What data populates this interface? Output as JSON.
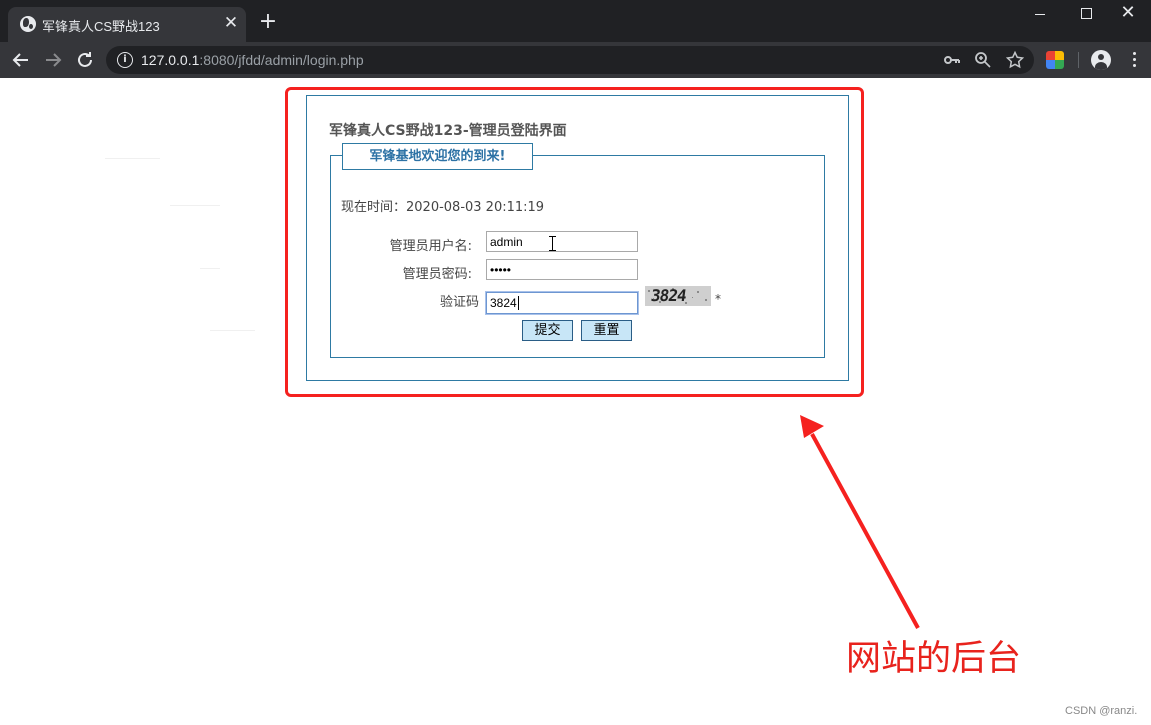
{
  "browser": {
    "tab_title": "军锋真人CS野战123",
    "tab_close": "✕",
    "new_tab": "+",
    "url_host": "127.0.0.1",
    "url_rest": ":8080/jfdd/admin/login.php",
    "window_controls": {
      "close": "✕"
    },
    "icons": [
      "globe-icon",
      "back-icon",
      "forward-icon",
      "reload-icon",
      "info-icon",
      "key-icon",
      "zoom-icon",
      "star-icon",
      "extension-icon",
      "profile-icon",
      "menu-icon"
    ]
  },
  "login": {
    "heading": "军锋真人CS野战123-管理员登陆界面",
    "legend": "军锋基地欢迎您的到来!",
    "time_text": "现在时间：2020-08-03 20:11:19",
    "username_label": "管理员用户名:",
    "username_value": "admin",
    "password_label": "管理员密码:",
    "password_value": "•••••",
    "captcha_label": "验证码",
    "captcha_value": "3824",
    "captcha_image_text": "3824",
    "required_mark": "*",
    "submit_label": "提交",
    "reset_label": "重置"
  },
  "annotation": {
    "text": "网站的后台",
    "color": "#e8231d"
  },
  "watermark": "CSDN @ranzi."
}
